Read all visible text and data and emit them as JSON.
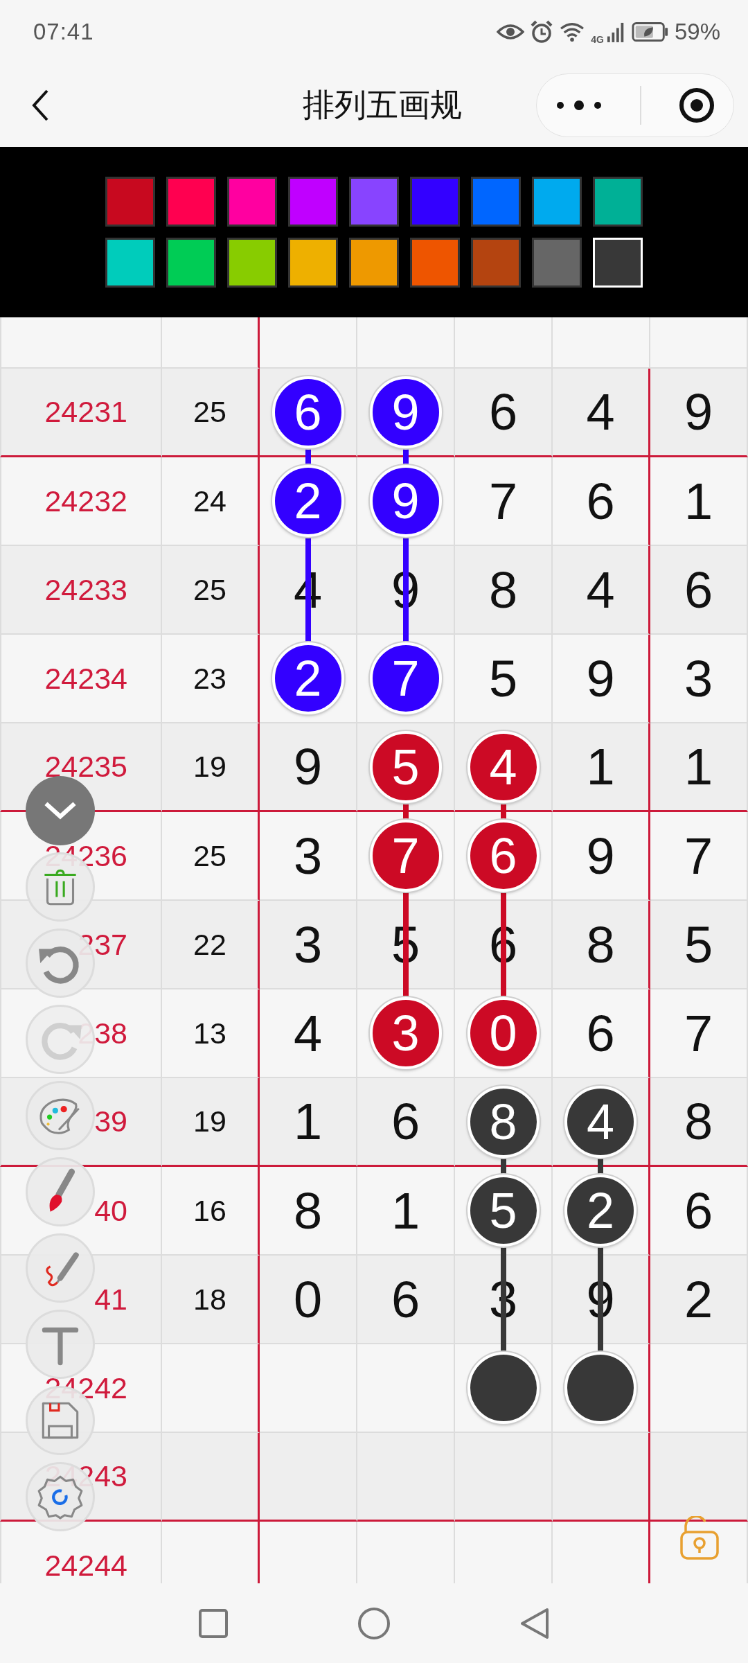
{
  "status_bar": {
    "time": "07:41",
    "network": "4G",
    "battery": "59%"
  },
  "title_bar": {
    "title": "排列五画规"
  },
  "palette": [
    {
      "color": "#c8091f",
      "selected": false
    },
    {
      "color": "#ff0050",
      "selected": false
    },
    {
      "color": "#ff00a0",
      "selected": false
    },
    {
      "color": "#c000ff",
      "selected": false
    },
    {
      "color": "#8844ff",
      "selected": false
    },
    {
      "color": "#3300ff",
      "selected": false
    },
    {
      "color": "#0066ff",
      "selected": false
    },
    {
      "color": "#00aaee",
      "selected": false
    },
    {
      "color": "#00b096",
      "selected": false
    },
    {
      "color": "#00ccbb",
      "selected": false
    },
    {
      "color": "#00cc55",
      "selected": false
    },
    {
      "color": "#88cc00",
      "selected": false
    },
    {
      "color": "#eeb000",
      "selected": false
    },
    {
      "color": "#ee9900",
      "selected": false
    },
    {
      "color": "#ee5500",
      "selected": false
    },
    {
      "color": "#b44410",
      "selected": false
    },
    {
      "color": "#666666",
      "selected": false
    },
    {
      "color": "#383838",
      "selected": true
    }
  ],
  "rows": [
    {
      "issue": "24231",
      "sum": "25",
      "divider_below": true,
      "cells": [
        {
          "digit": "6",
          "color": "#3300ff"
        },
        {
          "digit": "9",
          "color": "#3300ff"
        },
        {
          "digit": "6"
        },
        {
          "digit": "4"
        },
        {
          "digit": "9"
        }
      ]
    },
    {
      "issue": "24232",
      "sum": "24",
      "divider_below": false,
      "cells": [
        {
          "digit": "2",
          "color": "#3300ff"
        },
        {
          "digit": "9",
          "color": "#3300ff"
        },
        {
          "digit": "7"
        },
        {
          "digit": "6"
        },
        {
          "digit": "1"
        }
      ]
    },
    {
      "issue": "24233",
      "sum": "25",
      "divider_below": false,
      "cells": [
        {
          "digit": "4"
        },
        {
          "digit": "9"
        },
        {
          "digit": "8"
        },
        {
          "digit": "4"
        },
        {
          "digit": "6"
        }
      ]
    },
    {
      "issue": "24234",
      "sum": "23",
      "divider_below": false,
      "cells": [
        {
          "digit": "2",
          "color": "#3300ff"
        },
        {
          "digit": "7",
          "color": "#3300ff"
        },
        {
          "digit": "5"
        },
        {
          "digit": "9"
        },
        {
          "digit": "3"
        }
      ]
    },
    {
      "issue": "24235",
      "sum": "19",
      "divider_below": true,
      "cells": [
        {
          "digit": "9"
        },
        {
          "digit": "5",
          "color": "#cc0a25"
        },
        {
          "digit": "4",
          "color": "#cc0a25"
        },
        {
          "digit": "1"
        },
        {
          "digit": "1"
        }
      ]
    },
    {
      "issue": "24236",
      "sum": "25",
      "divider_below": false,
      "cells": [
        {
          "digit": "3"
        },
        {
          "digit": "7",
          "color": "#cc0a25"
        },
        {
          "digit": "6",
          "color": "#cc0a25"
        },
        {
          "digit": "9"
        },
        {
          "digit": "7"
        }
      ]
    },
    {
      "issue": "237",
      "sum": "22",
      "divider_below": false,
      "cells": [
        {
          "digit": "3"
        },
        {
          "digit": "5"
        },
        {
          "digit": "6"
        },
        {
          "digit": "8"
        },
        {
          "digit": "5"
        }
      ]
    },
    {
      "issue": "238",
      "sum": "13",
      "divider_below": false,
      "cells": [
        {
          "digit": "4"
        },
        {
          "digit": "3",
          "color": "#cc0a25"
        },
        {
          "digit": "0",
          "color": "#cc0a25"
        },
        {
          "digit": "6"
        },
        {
          "digit": "7"
        }
      ]
    },
    {
      "issue": "39",
      "sum": "19",
      "divider_below": true,
      "cells": [
        {
          "digit": "1"
        },
        {
          "digit": "6"
        },
        {
          "digit": "8",
          "color": "#383838"
        },
        {
          "digit": "4",
          "color": "#383838"
        },
        {
          "digit": "8"
        }
      ]
    },
    {
      "issue": "40",
      "sum": "16",
      "divider_below": false,
      "cells": [
        {
          "digit": "8"
        },
        {
          "digit": "1"
        },
        {
          "digit": "5",
          "color": "#383838"
        },
        {
          "digit": "2",
          "color": "#383838"
        },
        {
          "digit": "6"
        }
      ]
    },
    {
      "issue": "41",
      "sum": "18",
      "divider_below": false,
      "cells": [
        {
          "digit": "0"
        },
        {
          "digit": "6"
        },
        {
          "digit": "3"
        },
        {
          "digit": "9"
        },
        {
          "digit": "2"
        }
      ]
    },
    {
      "issue": "24242",
      "divider_below": false,
      "cells": [
        {},
        {},
        {
          "color": "#383838"
        },
        {
          "color": "#383838"
        },
        {}
      ]
    },
    {
      "issue": "24243",
      "divider_below": true
    },
    {
      "issue": "24244",
      "divider_below": false
    }
  ],
  "tools": [
    {
      "kind": "collapse"
    },
    {
      "kind": "trash"
    },
    {
      "kind": "undo",
      "disabled": false
    },
    {
      "kind": "redo",
      "disabled": true
    },
    {
      "kind": "palette"
    },
    {
      "kind": "brush"
    },
    {
      "kind": "pen"
    },
    {
      "kind": "text"
    },
    {
      "kind": "save"
    },
    {
      "kind": "settings"
    }
  ]
}
